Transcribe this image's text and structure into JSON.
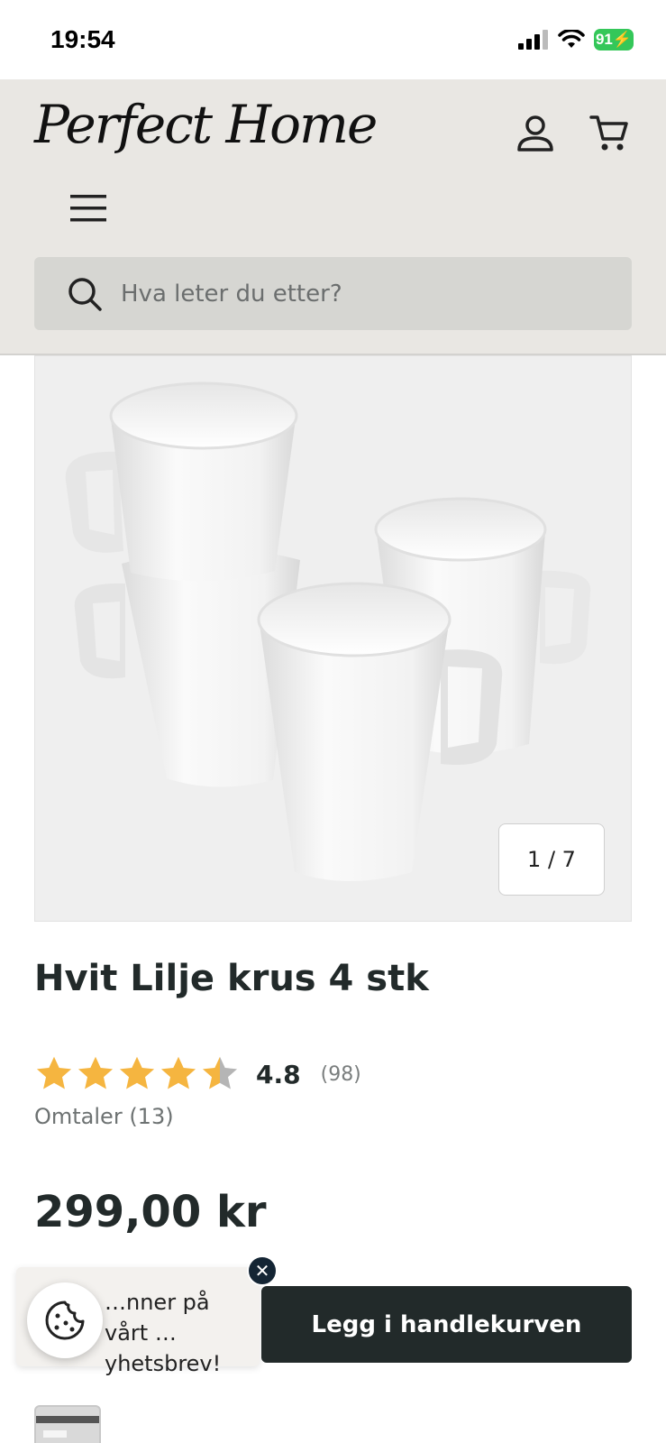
{
  "status_bar": {
    "time": "19:54",
    "battery": "91"
  },
  "header": {
    "logo_text": "Perfect Home",
    "icons": [
      "account-icon",
      "cart-icon",
      "menu-icon"
    ]
  },
  "search": {
    "placeholder": "Hva leter du etter?"
  },
  "gallery": {
    "counter": "1 / 7",
    "current": 1,
    "total": 7
  },
  "product": {
    "title": "Hvit Lilje krus 4 stk",
    "rating": "4.8",
    "rating_numeric": 4.8,
    "rating_count": "(98)",
    "reviews_link": "Omtaler (13)",
    "price": "299,00 kr"
  },
  "newsletter": {
    "text": "…nner på vårt …yhetsbrev!",
    "close_label": "✕"
  },
  "cart_button": {
    "label": "Legg i handlekurven"
  },
  "colors": {
    "header_bg": "#e9e7e3",
    "star": "#f5b540",
    "star_empty": "#b5b5b5",
    "button_bg": "#222a2a",
    "text": "#222a2a"
  }
}
